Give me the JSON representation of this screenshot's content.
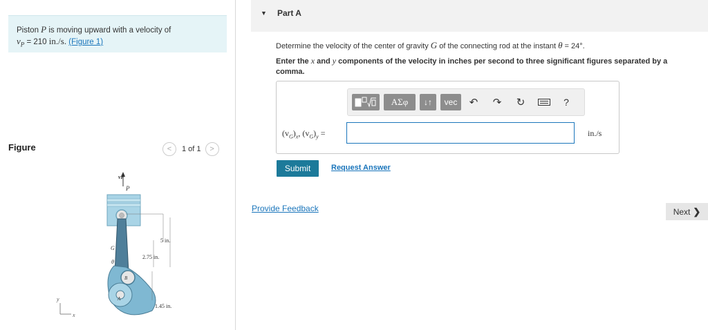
{
  "problem": {
    "text_pre": "Piston ",
    "var_P": "P",
    "text_mid": " is moving upward with a velocity of",
    "vel_sym": "v",
    "vel_sub": "P",
    "vel_val": " = 210 ",
    "vel_unit": "in./s.",
    "figure_link": "(Figure 1)"
  },
  "figure": {
    "label": "Figure",
    "pager_text": "1 of 1",
    "prev_icon": "chevron-left",
    "next_icon": "chevron-right",
    "labels": {
      "vp": "vP",
      "p": "P",
      "g": "G",
      "theta": "θ",
      "b": "B",
      "a": "A",
      "dim_5": "5 in.",
      "dim_275": "2.75 in.",
      "dim_145": "1.45 in.",
      "axis_y": "y",
      "axis_x": "x"
    }
  },
  "part": {
    "arrow_icon": "caret-down",
    "title": "Part A",
    "question_pre": "Determine the velocity of the center of gravity ",
    "question_G": "G",
    "question_mid": " of the connecting rod at the instant ",
    "question_theta": "θ",
    "question_val": " = 24°",
    "question_end": ".",
    "instruction_pre": "Enter the ",
    "instruction_x": "x",
    "instruction_and": " and ",
    "instruction_y": "y",
    "instruction_post": " components of the velocity in inches per second to three significant figures separated by a comma."
  },
  "toolbar": {
    "templates_icon": "template-icon",
    "greek_label": "ΑΣφ",
    "updown_label": "↓↑",
    "vec_label": "vec",
    "undo_icon": "undo-arrow",
    "redo_icon": "redo-arrow",
    "reset_icon": "reset",
    "keyboard_icon": "keyboard",
    "help_label": "?"
  },
  "answer": {
    "label_pre": "(v",
    "label_sub1": "G",
    "label_mid": ")",
    "label_x": "x",
    "label_sep": ", (v",
    "label_sub2": "G",
    "label_mid2": ")",
    "label_y": "y",
    "label_eq": " =",
    "value": "",
    "unit": "in./s"
  },
  "actions": {
    "submit": "Submit",
    "request": "Request Answer",
    "feedback": "Provide Feedback",
    "next": "Next",
    "next_icon": "❯"
  },
  "colors": {
    "accent": "#1c7a9a",
    "link": "#1a75bb",
    "problem_bg": "#e5f4f7",
    "toolbar_btn": "#8d8d8d"
  }
}
